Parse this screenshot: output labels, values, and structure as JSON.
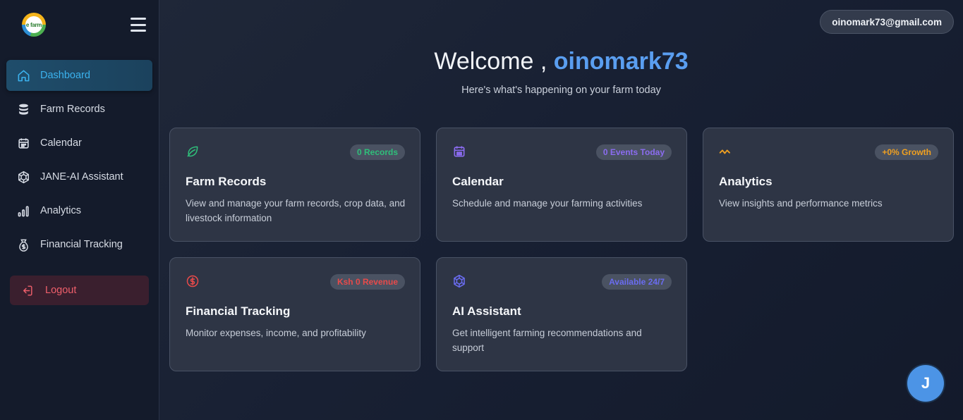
{
  "brand": {
    "logo_text": "e farm"
  },
  "sidebar": {
    "items": [
      {
        "label": "Dashboard",
        "icon": "home-icon",
        "active": true
      },
      {
        "label": "Farm Records",
        "icon": "database-icon",
        "active": false
      },
      {
        "label": "Calendar",
        "icon": "calendar-icon",
        "active": false
      },
      {
        "label": "JANE-AI Assistant",
        "icon": "ai-hexagon-icon",
        "active": false
      },
      {
        "label": "Analytics",
        "icon": "bar-chart-icon",
        "active": false
      },
      {
        "label": "Financial Tracking",
        "icon": "money-icon",
        "active": false
      }
    ],
    "logout_label": "Logout"
  },
  "header": {
    "user_email": "oinomark73@gmail.com"
  },
  "welcome": {
    "prefix": "Welcome , ",
    "username": "oinomark73",
    "subtitle": "Here's what's happening on your farm today"
  },
  "cards": [
    {
      "title": "Farm Records",
      "badge": "0 Records",
      "badge_color": "#2fbf7a",
      "icon": "leaf-icon",
      "icon_color": "#2fbf7a",
      "description": "View and manage your farm records, crop data, and livestock information"
    },
    {
      "title": "Calendar",
      "badge": "0 Events Today",
      "badge_color": "#8b6cf0",
      "icon": "calendar-icon",
      "icon_color": "#8b6cf0",
      "description": "Schedule and manage your farming activities"
    },
    {
      "title": "Analytics",
      "badge": "+0% Growth",
      "badge_color": "#f0a020",
      "icon": "activity-icon",
      "icon_color": "#f0a020",
      "description": "View insights and performance metrics"
    },
    {
      "title": "Financial Tracking",
      "badge": "Ksh 0 Revenue",
      "badge_color": "#e84a4a",
      "icon": "dollar-circle-icon",
      "icon_color": "#e84a4a",
      "description": "Monitor expenses, income, and profitability"
    },
    {
      "title": "AI Assistant",
      "badge": "Available 24/7",
      "badge_color": "#6a6cf0",
      "icon": "ai-hexagon-icon",
      "icon_color": "#6a6cf0",
      "description": "Get intelligent farming recommendations and support"
    }
  ],
  "assistant_fab": {
    "letter": "J"
  }
}
